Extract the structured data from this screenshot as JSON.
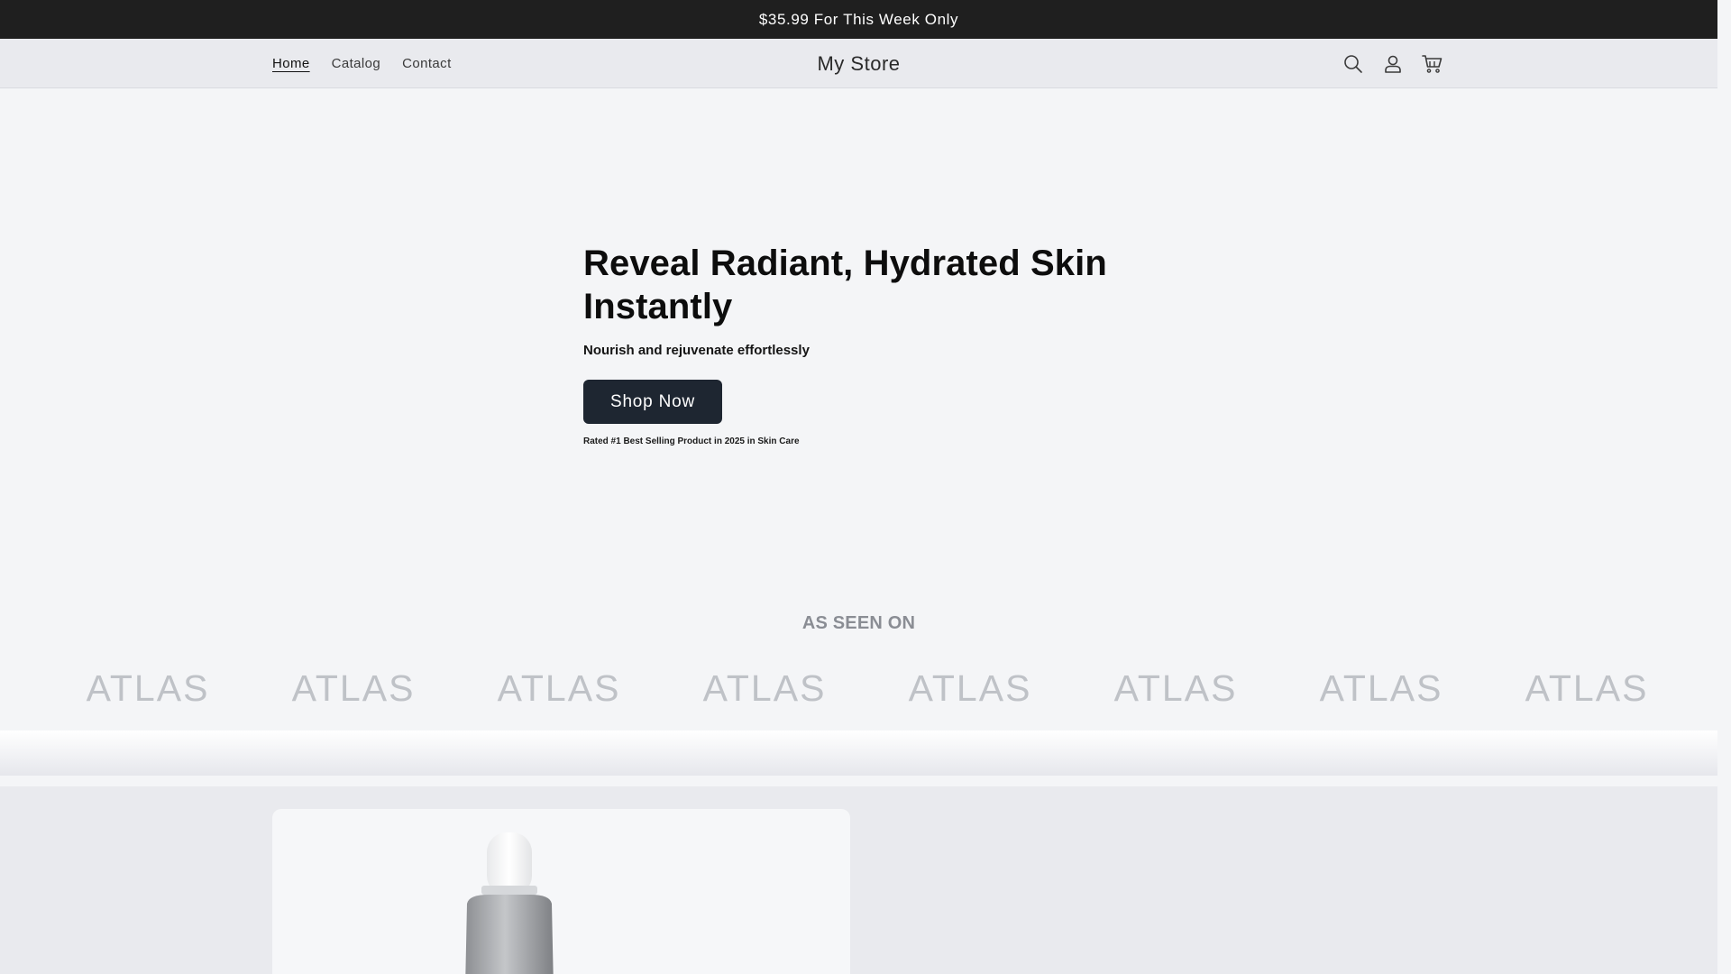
{
  "announcement": {
    "text": "$35.99 For This Week Only"
  },
  "header": {
    "nav": [
      {
        "label": "Home",
        "active": true
      },
      {
        "label": "Catalog",
        "active": false
      },
      {
        "label": "Contact",
        "active": false
      }
    ],
    "store_name": "My Store",
    "icons": [
      "search-icon",
      "account-icon",
      "cart-icon"
    ]
  },
  "hero": {
    "title": "Reveal Radiant, Hydrated Skin Instantly",
    "subtitle": "Nourish and rejuvenate effortlessly",
    "cta_label": "Shop Now",
    "rating_note": "Rated #1 Best Selling Product in 2025 in Skin Care"
  },
  "as_seen_on": {
    "title": "AS SEEN ON",
    "logos": [
      "ATLAS",
      "ATLAS",
      "ATLAS",
      "ATLAS",
      "ATLAS",
      "ATLAS",
      "ATLAS",
      "ATLAS"
    ]
  },
  "colors": {
    "announcement_bg": "#1f1f1f",
    "header_bg": "#e9eaee",
    "page_bg": "#f4f5f7",
    "button_bg": "#1e2631",
    "logo_text": "#bfc2c7"
  }
}
